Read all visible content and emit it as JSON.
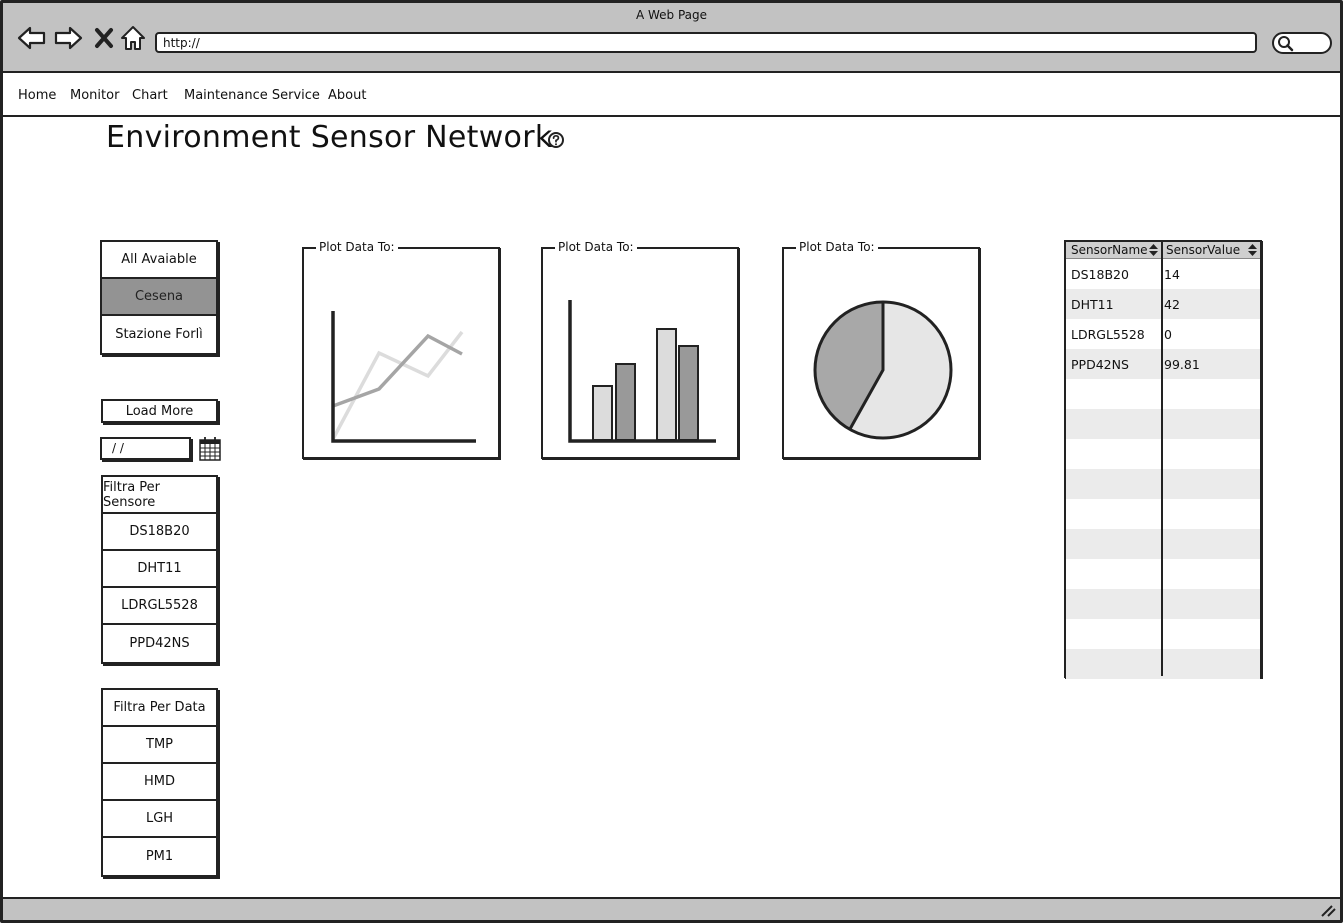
{
  "window": {
    "title": "A Web Page"
  },
  "browser": {
    "url": "http://"
  },
  "menu": [
    "Home",
    "Monitor",
    "Chart",
    "Maintenance Service",
    "About"
  ],
  "page": {
    "title": "Environment Sensor Network"
  },
  "locations": {
    "items": [
      "All Avaiable",
      "Cesena",
      "Stazione Forlì"
    ],
    "selected": "Cesena"
  },
  "controls": {
    "load_more": "Load More",
    "date_value": "/ /"
  },
  "sensor_filter": {
    "header": "Filtra Per Sensore",
    "items": [
      "DS18B20",
      "DHT11",
      "LDRGL5528",
      "PPD42NS"
    ]
  },
  "data_filter": {
    "header": "Filtra Per Data",
    "items": [
      "TMP",
      "HMD",
      "LGH",
      "PM1"
    ]
  },
  "charts": [
    {
      "label": "Plot Data To:",
      "kind": "line"
    },
    {
      "label": "Plot Data To:",
      "kind": "bar"
    },
    {
      "label": "Plot Data To:",
      "kind": "pie"
    }
  ],
  "table": {
    "columns": [
      "SensorName",
      "SensorValue"
    ],
    "rows": [
      [
        "DS18B20",
        "14"
      ],
      [
        "DHT11",
        "42"
      ],
      [
        "LDRGL5528",
        "0"
      ],
      [
        "PPD42NS",
        "99.81"
      ]
    ]
  },
  "colors": {
    "chrome": "#c2c2c2",
    "selected": "#939393",
    "outline": "#222222"
  }
}
